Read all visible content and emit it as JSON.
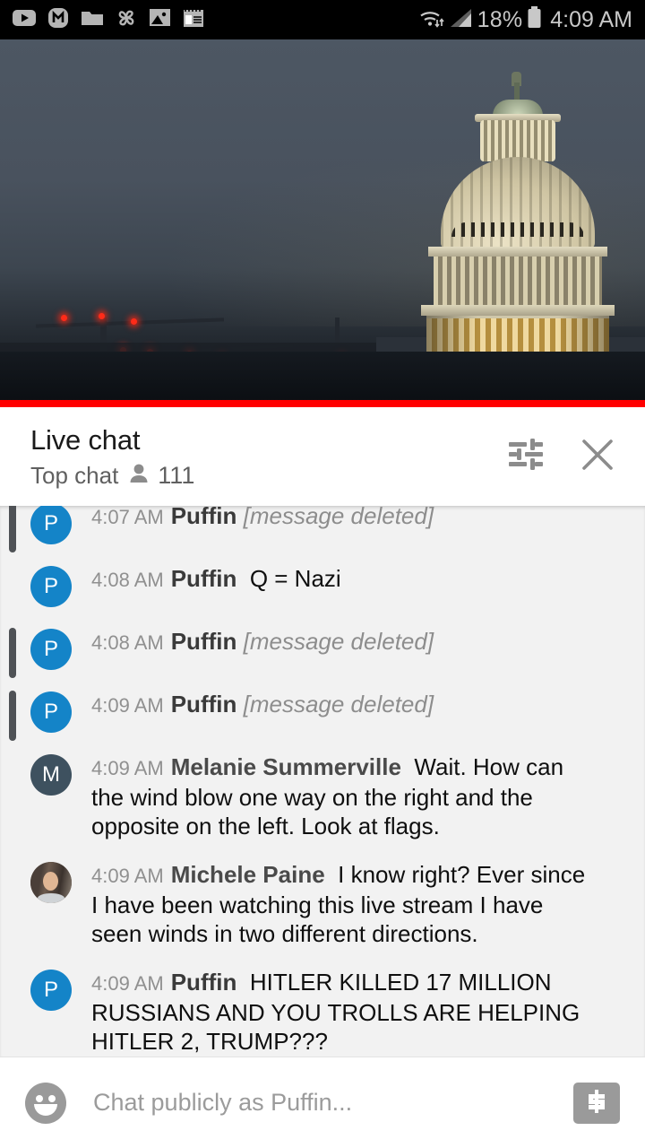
{
  "statusbar": {
    "icons": [
      "youtube-icon",
      "messenger-icon",
      "folder-icon",
      "pinwheel-icon",
      "photos-icon",
      "notepad-icon"
    ],
    "wifi_icon": "wifi-icon",
    "signal_icon": "cell-signal-icon",
    "battery_percent": "18%",
    "battery_icon": "battery-icon",
    "clock": "4:09 AM"
  },
  "video": {
    "scene": "US Capitol dome at dusk with construction cranes",
    "progress_color": "#ff0000"
  },
  "chat_header": {
    "title": "Live chat",
    "mode": "Top chat",
    "viewer_icon": "person-icon",
    "viewer_count": "111",
    "filter_icon": "tune-filter-icon",
    "close_icon": "close-icon"
  },
  "messages": [
    {
      "time": "4:07 AM",
      "author": "Puffin",
      "text": "[message deleted]",
      "deleted": true,
      "moderated": true,
      "avatar": {
        "type": "initial",
        "initial": "P",
        "color": "#1484c8"
      },
      "clipped": true
    },
    {
      "time": "4:08 AM",
      "author": "Puffin",
      "text": "Q = Nazi",
      "deleted": false,
      "moderated": false,
      "avatar": {
        "type": "initial",
        "initial": "P",
        "color": "#1484c8"
      },
      "clipped": false
    },
    {
      "time": "4:08 AM",
      "author": "Puffin",
      "text": "[message deleted]",
      "deleted": true,
      "moderated": true,
      "avatar": {
        "type": "initial",
        "initial": "P",
        "color": "#1484c8"
      },
      "clipped": false
    },
    {
      "time": "4:09 AM",
      "author": "Puffin",
      "text": "[message deleted]",
      "deleted": true,
      "moderated": true,
      "avatar": {
        "type": "initial",
        "initial": "P",
        "color": "#1484c8"
      },
      "clipped": false
    },
    {
      "time": "4:09 AM",
      "author": "Melanie Summerville",
      "text": "Wait. How can the wind blow one way on the right and the opposite on the left. Look at flags.",
      "deleted": false,
      "moderated": false,
      "avatar": {
        "type": "initial",
        "initial": "M",
        "color": "#3e515f"
      },
      "clipped": false
    },
    {
      "time": "4:09 AM",
      "author": "Michele Paine",
      "text": "I know right? Ever since I have been watching this live stream I have seen winds in two different directions.",
      "deleted": false,
      "moderated": false,
      "avatar": {
        "type": "photo",
        "initial": "",
        "color": "#6b5a4e"
      },
      "clipped": false
    },
    {
      "time": "4:09 AM",
      "author": "Puffin",
      "text": "HITLER KILLED 17 MILLION RUSSIANS AND YOU TROLLS ARE HELPING HITLER 2, TRUMP???",
      "deleted": false,
      "moderated": false,
      "avatar": {
        "type": "initial",
        "initial": "P",
        "color": "#1484c8"
      },
      "clipped": false
    }
  ],
  "input_bar": {
    "emoji_icon": "emoji-smiley-icon",
    "placeholder": "Chat publicly as Puffin...",
    "value": "",
    "superchat_icon": "dollar-superchat-icon"
  }
}
